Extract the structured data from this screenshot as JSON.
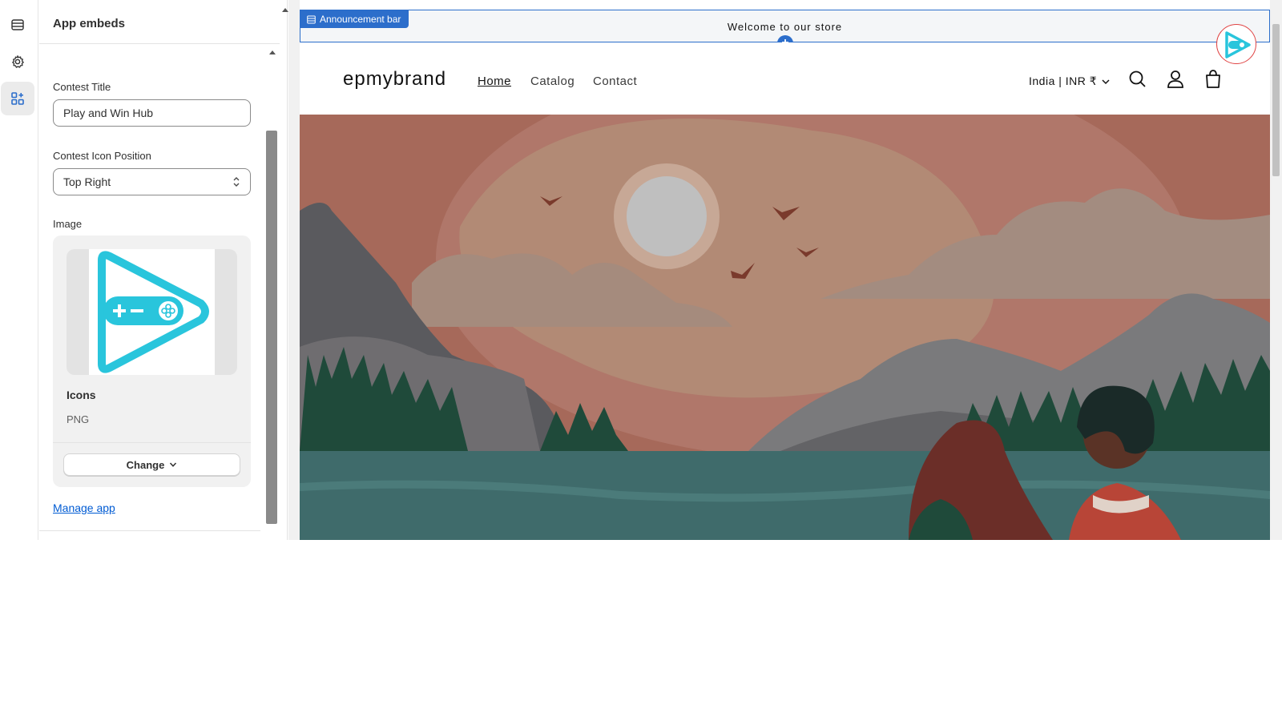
{
  "rail": {
    "items": [
      {
        "icon": "sections-icon"
      },
      {
        "icon": "gear-icon"
      },
      {
        "icon": "app-embeds-icon"
      }
    ]
  },
  "panel": {
    "title": "App embeds",
    "contest_title": {
      "label": "Contest Title",
      "value": "Play and Win Hub"
    },
    "icon_position": {
      "label": "Contest Icon Position",
      "value": "Top Right"
    },
    "image": {
      "label": "Image",
      "file_name": "Icons",
      "file_type": "PNG",
      "change_label": "Change"
    },
    "manage_link": "Manage app"
  },
  "preview": {
    "announcement_tag": "Announcement bar",
    "announcement_text": "Welcome to our store",
    "brand": "epmybrand",
    "nav": [
      "Home",
      "Catalog",
      "Contact"
    ],
    "country": "India | INR ₹"
  },
  "colors": {
    "accent": "#2c6ecb",
    "logo_cyan": "#29c5dc",
    "hero_sky": "#a6695a",
    "hero_water": "#3f6b6b",
    "link": "#005bd3"
  }
}
